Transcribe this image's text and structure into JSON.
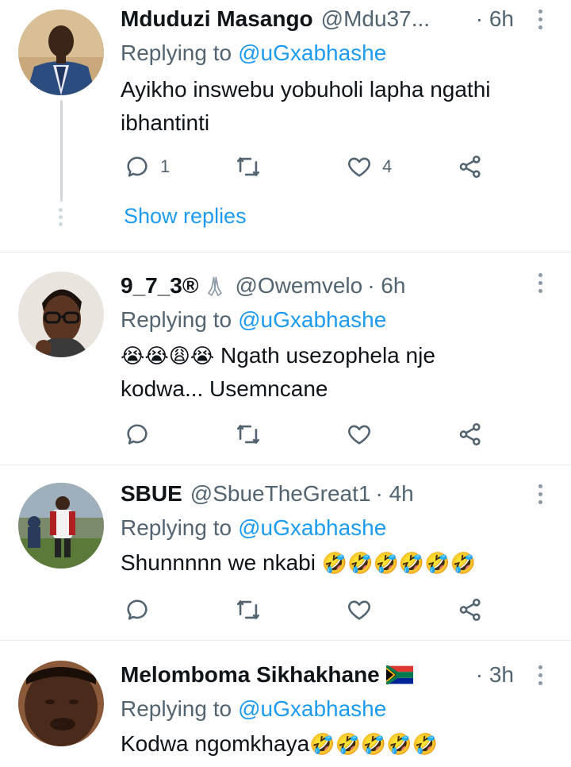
{
  "tweets": [
    {
      "name": "Mduduzi Masango",
      "handle": "@Mdu37...",
      "time": "· 6h",
      "replying_prefix": "Replying to",
      "replying_to": "@uGxabhashe",
      "text": "Ayikho inswebu yobuholi lapha ngathi ibhantinti",
      "reply_count": "1",
      "retweet_count": "",
      "like_count": "4",
      "show_replies": "Show replies"
    },
    {
      "name": "9_7_3®",
      "handle": "@Owemvelo",
      "time": "· 6h",
      "replying_prefix": "Replying to",
      "replying_to": "@uGxabhashe",
      "emojis": "😭😭😩😭",
      "text": "Ngath usezophela nje kodwa... Usemncane"
    },
    {
      "name": "SBUE",
      "handle": "@SbueTheGreat1",
      "time": "· 4h",
      "replying_prefix": "Replying to",
      "replying_to": "@uGxabhashe",
      "text": "Shunnnnn we nkabi",
      "emojis": "🤣🤣🤣🤣🤣🤣"
    },
    {
      "name": "Melomboma Sikhakhane",
      "time": "· 3h",
      "replying_prefix": "Replying to",
      "replying_to": "@uGxabhashe",
      "text": "Kodwa ngomkhaya",
      "emojis": "🤣🤣🤣🤣🤣"
    }
  ],
  "icons": {
    "reply": "reply-icon",
    "retweet": "retweet-icon",
    "like": "heart-icon",
    "share": "share-icon",
    "more": "more-icon"
  },
  "colors": {
    "link": "#1d9bf0",
    "secondary": "#536471",
    "divider": "#e6ecf0"
  }
}
